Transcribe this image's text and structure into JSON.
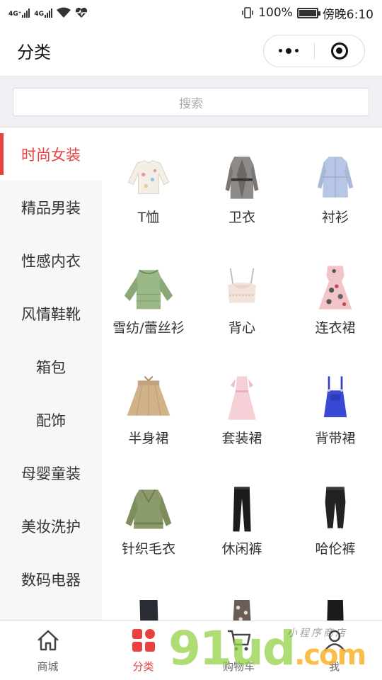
{
  "status_bar": {
    "net1": "4G⁺",
    "net2": "4G",
    "battery_text": "100%",
    "time": "傍晚6:10"
  },
  "nav": {
    "title": "分类"
  },
  "search": {
    "placeholder": "搜索"
  },
  "sidebar": {
    "items": [
      {
        "label": "时尚女装",
        "active": true
      },
      {
        "label": "精品男装"
      },
      {
        "label": "性感内衣"
      },
      {
        "label": "风情鞋靴"
      },
      {
        "label": "箱包"
      },
      {
        "label": "配饰"
      },
      {
        "label": "母婴童装"
      },
      {
        "label": "美妆洗护"
      },
      {
        "label": "数码电器"
      }
    ]
  },
  "grid": {
    "items": [
      {
        "label": "T恤",
        "icon": "sweater-image"
      },
      {
        "label": "卫衣",
        "icon": "coat-image"
      },
      {
        "label": "衬衫",
        "icon": "shirt-dress-image"
      },
      {
        "label": "雪纺/蕾丝衫",
        "icon": "chiffon-blouse-image"
      },
      {
        "label": "背心",
        "icon": "lace-top-image"
      },
      {
        "label": "连衣裙",
        "icon": "floral-dress-image"
      },
      {
        "label": "半身裙",
        "icon": "skirt-image"
      },
      {
        "label": "套装裙",
        "icon": "pink-dress-image"
      },
      {
        "label": "背带裙",
        "icon": "overall-dress-image"
      },
      {
        "label": "针织毛衣",
        "icon": "knit-sweater-image"
      },
      {
        "label": "休闲裤",
        "icon": "trousers-image"
      },
      {
        "label": "哈伦裤",
        "icon": "harem-pants-image"
      },
      {
        "label": "",
        "icon": "jeans-image"
      },
      {
        "label": "",
        "icon": "shorts-image"
      },
      {
        "label": "",
        "icon": "pants-image"
      }
    ]
  },
  "tabbar": {
    "items": [
      {
        "label": "商城",
        "icon": "home-icon"
      },
      {
        "label": "分类",
        "icon": "category-icon",
        "active": true
      },
      {
        "label": "购物车",
        "icon": "cart-icon"
      },
      {
        "label": "我",
        "icon": "user-icon"
      }
    ]
  },
  "watermark": {
    "text": "91ud",
    "suffix": ".com",
    "tag": "小程序商店"
  },
  "colors": {
    "accent": "#e94040",
    "sidebar_bg": "#f7f7f7",
    "search_bg": "#efeff4"
  }
}
